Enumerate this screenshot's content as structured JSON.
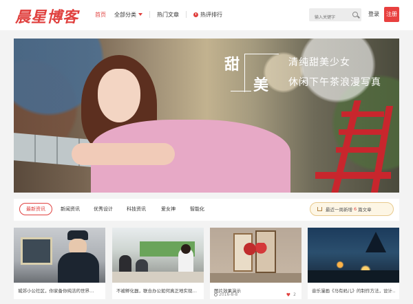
{
  "header": {
    "logo": "晨星博客",
    "nav": [
      {
        "label": "首页",
        "active": true
      },
      {
        "label": "全部分类",
        "has_dropdown": true
      },
      {
        "label": "热门文章"
      },
      {
        "label": "热评排行",
        "icon": "hot-icon"
      }
    ],
    "search_placeholder": "输入关键字",
    "login_label": "登录",
    "register_label": "注册"
  },
  "banner": {
    "char1": "甜",
    "char2": "美",
    "line1": "清纯甜美少女",
    "line2": "休闲下午茶浪漫写真"
  },
  "tabs": {
    "items": [
      "最新资讯",
      "新闻资讯",
      "优秀设计",
      "科技资讯",
      "爱女神",
      "智能化"
    ],
    "active_index": 0,
    "today_prefix": "最近一周新增",
    "today_count": "6",
    "today_suffix": "篇文章"
  },
  "cards": [
    {
      "title": "城郊小公社区，你家备你纯洁的世界…",
      "date": "",
      "likes": ""
    },
    {
      "title": "不被孵化器，联合办公如何真正地实现…",
      "date": "",
      "likes": ""
    },
    {
      "title": "图片效果演示",
      "date": "2016-8-8",
      "likes": "2"
    },
    {
      "title": "音乐漫画《马有蚂儿》的制作方法，设计…",
      "date": "",
      "likes": ""
    }
  ],
  "colors": {
    "accent": "#e0413f"
  }
}
